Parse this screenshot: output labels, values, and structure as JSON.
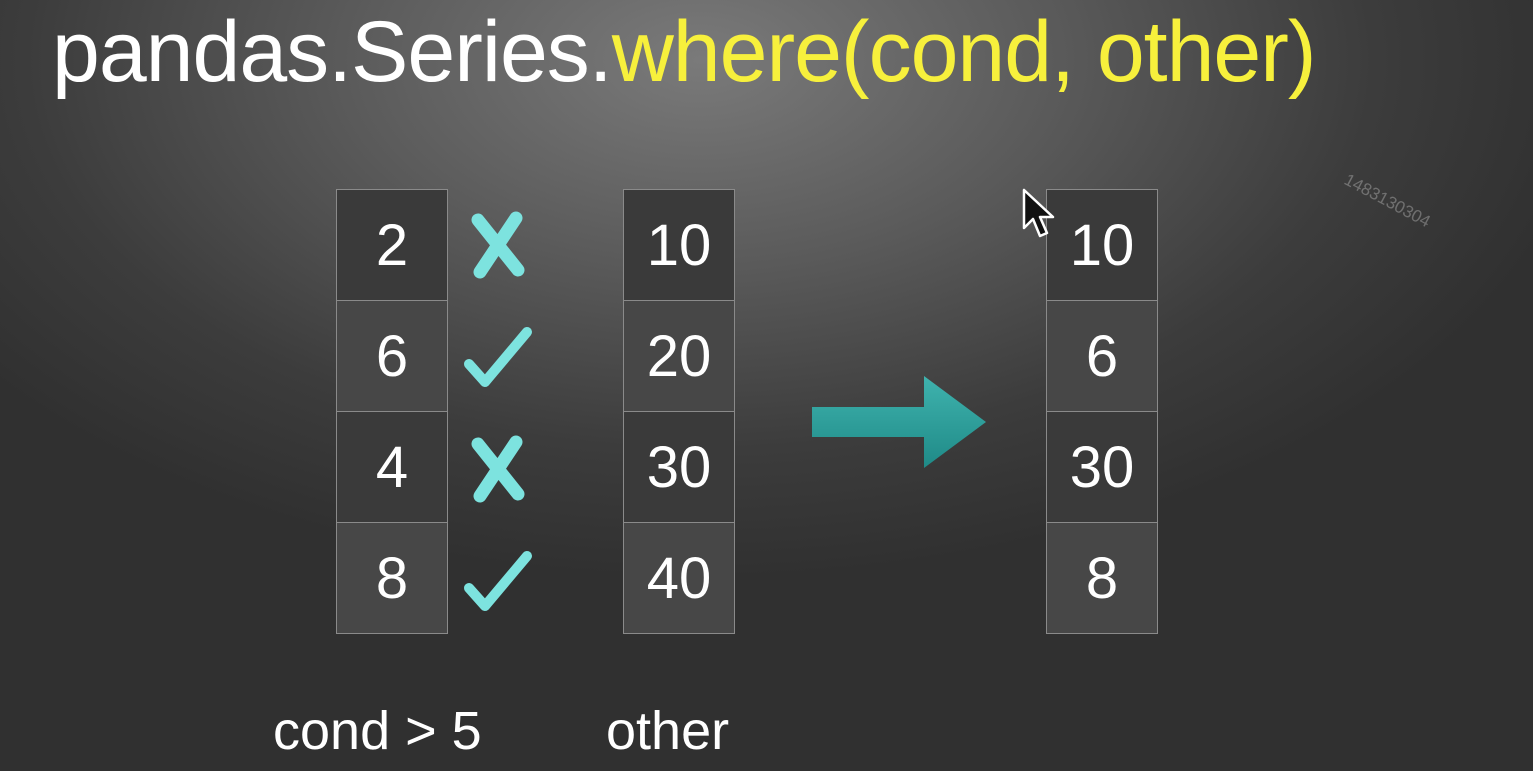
{
  "title": {
    "prefix": "pandas.Series.",
    "method": "where(cond, other)"
  },
  "series": {
    "values": [
      "2",
      "6",
      "4",
      "8"
    ],
    "label": "cond > 5"
  },
  "conditions": [
    {
      "result": false,
      "icon": "cross-icon"
    },
    {
      "result": true,
      "icon": "check-icon"
    },
    {
      "result": false,
      "icon": "cross-icon"
    },
    {
      "result": true,
      "icon": "check-icon"
    }
  ],
  "other": {
    "values": [
      "10",
      "20",
      "30",
      "40"
    ],
    "label": "other"
  },
  "result": {
    "values": [
      "10",
      "6",
      "30",
      "8"
    ]
  },
  "watermark": "1483130304",
  "colors": {
    "title_accent": "#f7f03c",
    "mark_color": "#7de3df",
    "arrow_color": "#2a9d9a"
  }
}
